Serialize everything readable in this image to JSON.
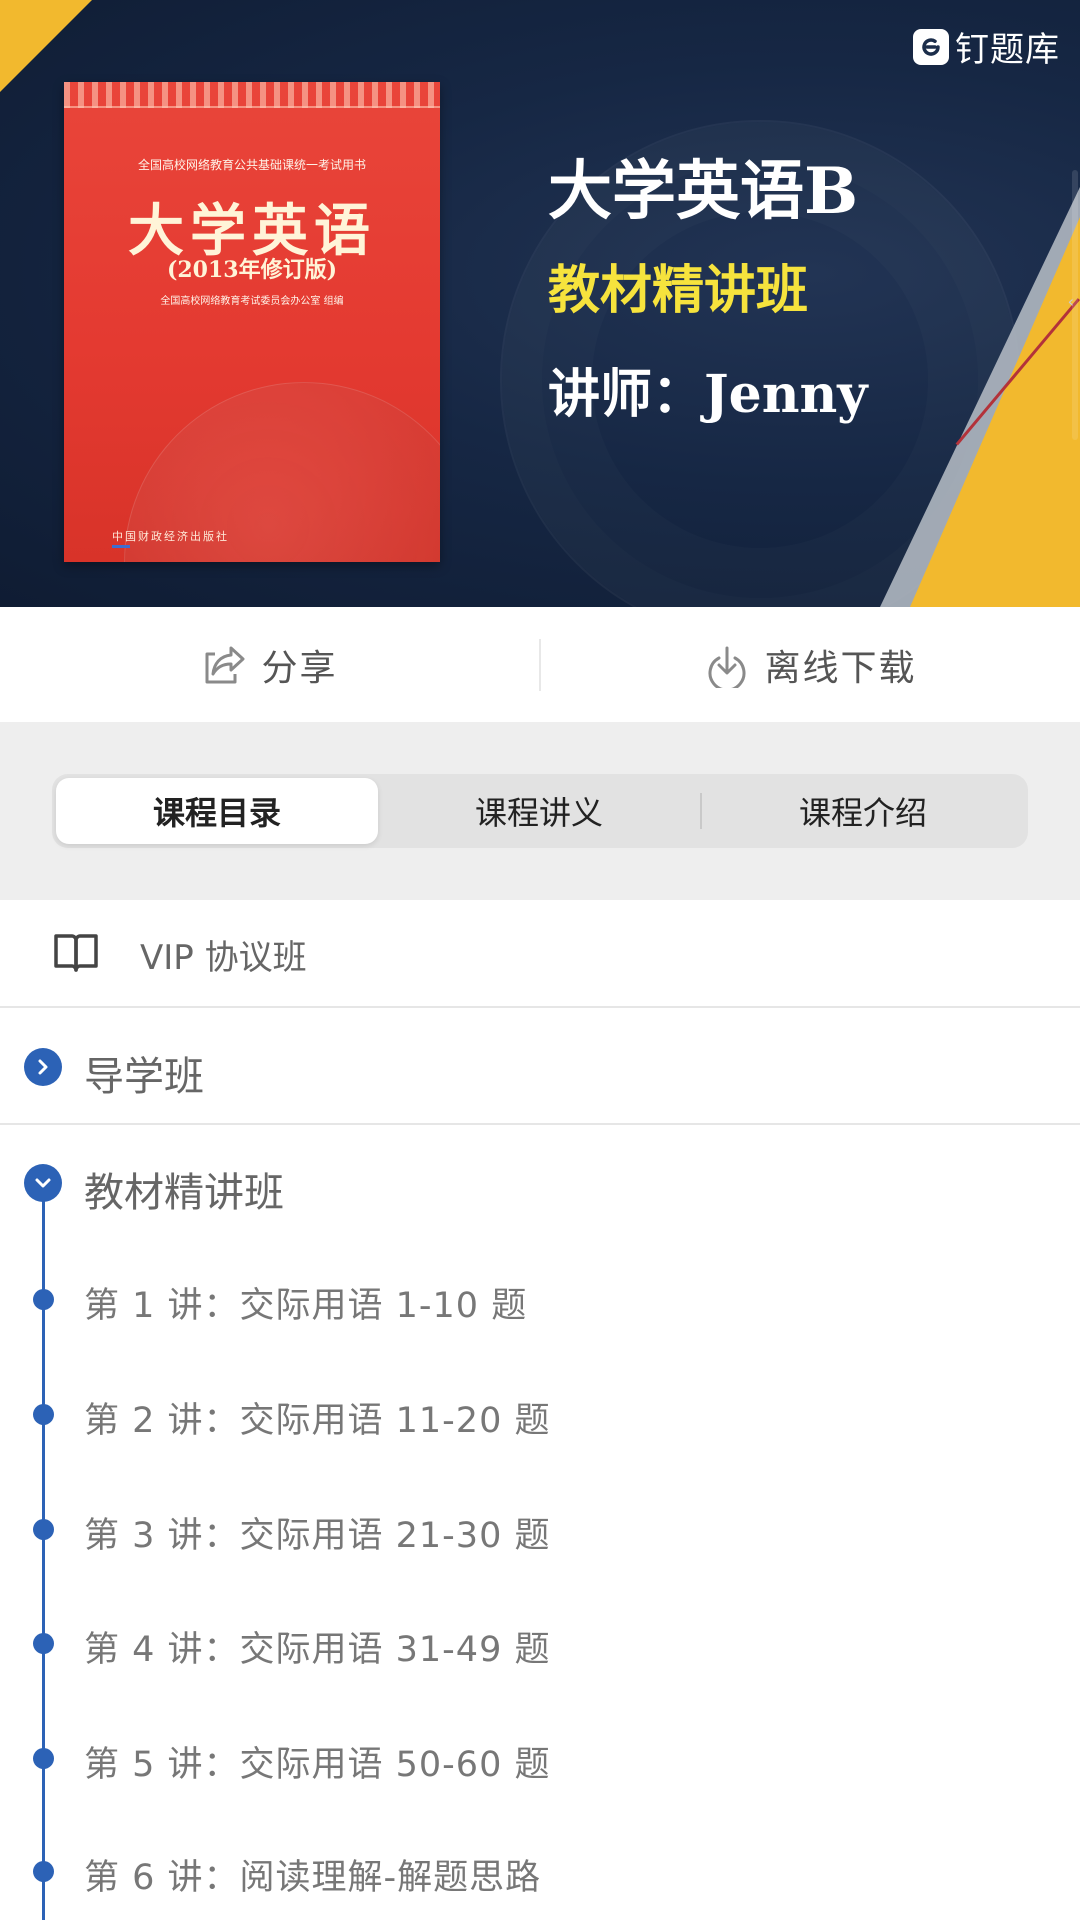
{
  "banner": {
    "brand": "钉题库",
    "book": {
      "series": "全国高校网络教育公共基础课统一考试用书",
      "title": "大学英语",
      "edition": "(2013年修订版)",
      "editor": "全国高校网络教育考试委员会办公室  组编",
      "publisher": "中国财政经济出版社"
    },
    "course_title": "大学英语B",
    "course_subtitle": "教材精讲班",
    "teacher": "讲师：Jenny"
  },
  "actions": {
    "share": "分享",
    "download": "离线下载"
  },
  "tabs": [
    {
      "label": "课程目录",
      "active": true
    },
    {
      "label": "课程讲义",
      "active": false
    },
    {
      "label": "课程介绍",
      "active": false
    }
  ],
  "vip_row": {
    "label": "VIP 协议班"
  },
  "sections": [
    {
      "label": "导学班",
      "expanded": false
    },
    {
      "label": "教材精讲班",
      "expanded": true
    }
  ],
  "lectures": [
    "第 1 讲：交际用语 1-10 题",
    "第 2 讲：交际用语 11-20 题",
    "第 3 讲：交际用语 21-30 题",
    "第 4 讲：交际用语 31-49 题",
    "第 5 讲：交际用语 50-60 题",
    "第 6 讲：阅读理解-解题思路"
  ],
  "colors": {
    "accent_blue": "#2c62b6",
    "highlight_yellow": "#f6e33d",
    "banner_dark": "#162744"
  },
  "icons": {
    "share": "share-icon",
    "download": "download-icon",
    "book": "open-book-icon",
    "collapsed": "chevron-right-icon",
    "expanded": "chevron-down-icon"
  }
}
